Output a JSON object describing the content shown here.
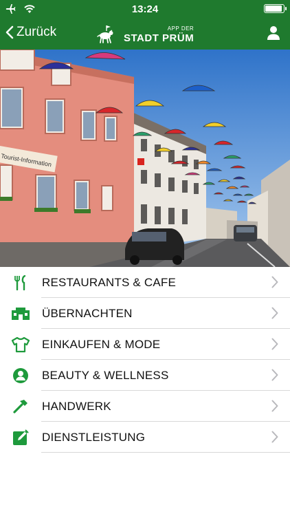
{
  "status_bar": {
    "time": "13:24"
  },
  "nav": {
    "back_label": "Zurück",
    "logo_small": "APP DER",
    "logo_big": "STADT PRÜM"
  },
  "hero": {
    "banner_text": "Tourist-Information"
  },
  "menu": {
    "items": [
      {
        "label": "RESTAURANTS & CAFE",
        "icon": "cutlery-icon"
      },
      {
        "label": "ÜBERNACHTEN",
        "icon": "house-icon"
      },
      {
        "label": "EINKAUFEN & MODE",
        "icon": "shirt-icon"
      },
      {
        "label": "BEAUTY & WELLNESS",
        "icon": "person-icon"
      },
      {
        "label": "HANDWERK",
        "icon": "hammer-icon"
      },
      {
        "label": "DIENSTLEISTUNG",
        "icon": "edit-icon"
      }
    ]
  },
  "colors": {
    "brand_green": "#1f7a2e",
    "icon_green": "#1e9a3c"
  }
}
